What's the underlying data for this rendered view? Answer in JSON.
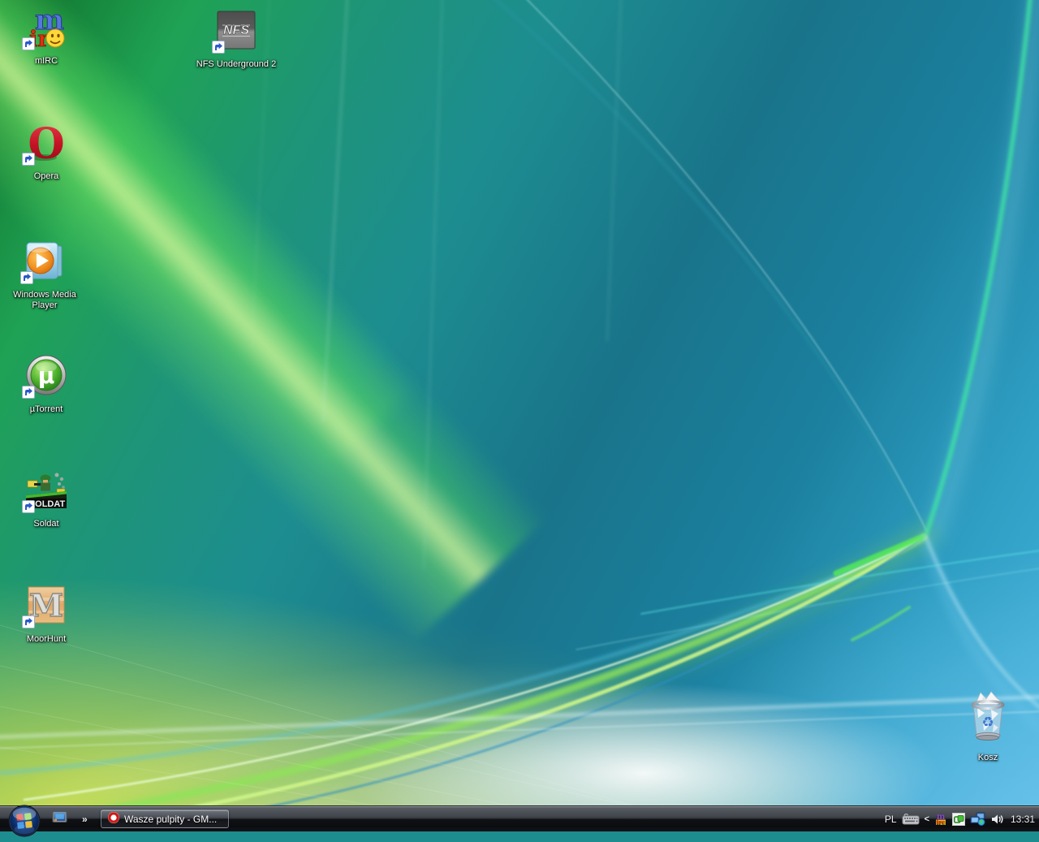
{
  "desktop": {
    "icons": [
      {
        "label": "mIRC",
        "glyph_m": "m",
        "glyph_ir": "ir"
      },
      {
        "label": "NFS Underground 2",
        "glyph": "NFS"
      },
      {
        "label": "Opera",
        "glyph": "O"
      },
      {
        "label": "Windows Media Player"
      },
      {
        "label": "µTorrent",
        "glyph": "µ"
      },
      {
        "label": "Soldat",
        "glyph": "SOLDAT"
      },
      {
        "label": "MoorHunt",
        "glyph": "M"
      },
      {
        "label": "Kosz"
      }
    ]
  },
  "taskbar": {
    "quicklaunch_chevron": "»",
    "task_button": {
      "label": "Wasze pulpity - GM..."
    },
    "tray": {
      "language": "PL",
      "collapse_chevron": "<",
      "clock": "13:31"
    }
  },
  "colors": {
    "aurora_green": "#3ed058",
    "aurora_teal": "#1d8d90",
    "aurora_sky": "#49b5de",
    "taskbar_dark": "#101216"
  }
}
